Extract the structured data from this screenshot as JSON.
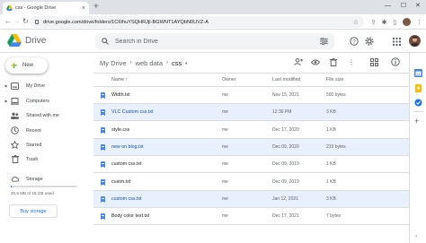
{
  "browser": {
    "tab_title": "css - Google Drive",
    "url": "drive.google.com/drive/folders/1C6IhuYSQHRJjI-BGWNT1AYQbN0UVZ-A",
    "new_tab_glyph": "+",
    "window_controls": [
      "—",
      "☐",
      "✕"
    ],
    "toolbar_icons": [
      "back-icon",
      "forward-icon",
      "reload-icon",
      "bookmark-star-icon",
      "share-icon",
      "extensions-icon",
      "reading-list-icon",
      "profile-icon",
      "menu-icon"
    ]
  },
  "drive": {
    "product_name": "Drive",
    "search_placeholder": "Search in Drive",
    "header_icons": [
      "help-icon",
      "settings-icon",
      "apps-grid-icon",
      "account-avatar"
    ],
    "new_button_label": "New",
    "nav": [
      {
        "label": "My Drive",
        "icon": "my-drive-icon",
        "expandable": true
      },
      {
        "label": "Computers",
        "icon": "computers-icon",
        "expandable": true
      },
      {
        "label": "Shared with me",
        "icon": "shared-icon",
        "expandable": false
      },
      {
        "label": "Recent",
        "icon": "recent-icon",
        "expandable": false
      },
      {
        "label": "Starred",
        "icon": "starred-icon",
        "expandable": false
      },
      {
        "label": "Trash",
        "icon": "trash-icon",
        "expandable": false
      }
    ],
    "storage": {
      "label": "Storage",
      "used_text": "20.6 MB of 15 GB used",
      "used_fraction": 0.01,
      "buy_label": "Buy storage"
    },
    "breadcrumb": [
      "My Drive",
      "web data",
      "css"
    ],
    "list_header": {
      "name": "Name",
      "owner": "Owner",
      "modified": "Last modified",
      "size": "File size",
      "sort_arrow": "↑"
    },
    "files": [
      {
        "name": "Width.txt",
        "owner": "me",
        "modified": "Nov 15, 2021",
        "size": "500 bytes",
        "selected": false
      },
      {
        "name": "VLC Custom css.txt",
        "owner": "me",
        "modified": "12:36 PM",
        "size": "3 KB",
        "selected": true
      },
      {
        "name": "style.css",
        "owner": "me",
        "modified": "Dec 17, 2020",
        "size": "1 KB",
        "selected": false
      },
      {
        "name": "new on blog.txt",
        "owner": "me",
        "modified": "Dec 09, 2020",
        "size": "219 bytes",
        "selected": true
      },
      {
        "name": "custom css.txt",
        "owner": "me",
        "modified": "Dec 09, 2019",
        "size": "1 KB",
        "selected": false
      },
      {
        "name": "custm.txt",
        "owner": "me",
        "modified": "Dec 09, 2019",
        "size": "1 KB",
        "selected": false
      },
      {
        "name": "custom css.txt",
        "owner": "me",
        "modified": "Jan 12, 2021",
        "size": "3 KB",
        "selected": true
      },
      {
        "name": "Body color text.txt",
        "owner": "me",
        "modified": "Dec 17, 2021",
        "size": "7 bytes",
        "selected": false
      }
    ],
    "colors": {
      "accent": "#1a73e8",
      "selected_row": "#e8f0fe",
      "file_icon": "#4285f4"
    }
  }
}
